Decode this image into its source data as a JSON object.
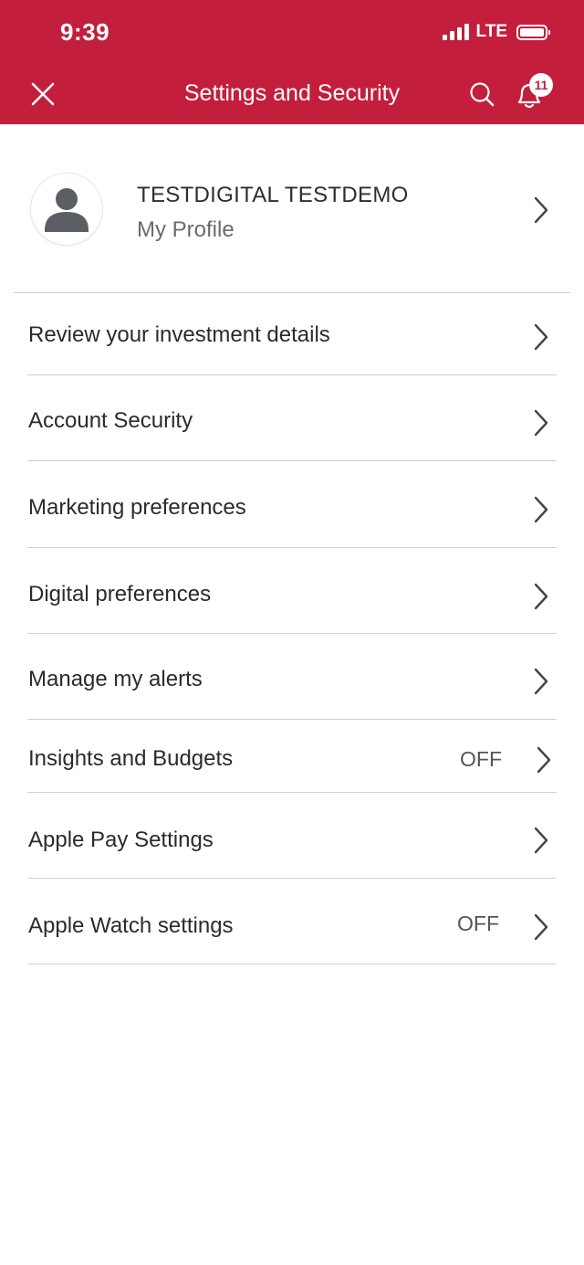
{
  "status_bar": {
    "time": "9:39",
    "network": "LTE"
  },
  "header": {
    "title": "Settings and Security",
    "notification_count": "11",
    "background_color": "#c41e3d",
    "icons": [
      "close-icon",
      "search-icon",
      "bell-icon"
    ]
  },
  "profile": {
    "name": "TESTDIGITAL TESTDEMO",
    "subtitle": "My Profile"
  },
  "menu": {
    "items": [
      {
        "label": "Review your investment details",
        "status": ""
      },
      {
        "label": "Account Security",
        "status": ""
      },
      {
        "label": "Marketing preferences",
        "status": ""
      },
      {
        "label": "Digital preferences",
        "status": ""
      },
      {
        "label": "Manage my alerts",
        "status": ""
      },
      {
        "label": "Insights and Budgets",
        "status": "OFF"
      },
      {
        "label": "Apple Pay Settings",
        "status": ""
      },
      {
        "label": "Apple Watch settings",
        "status": "OFF"
      }
    ]
  }
}
